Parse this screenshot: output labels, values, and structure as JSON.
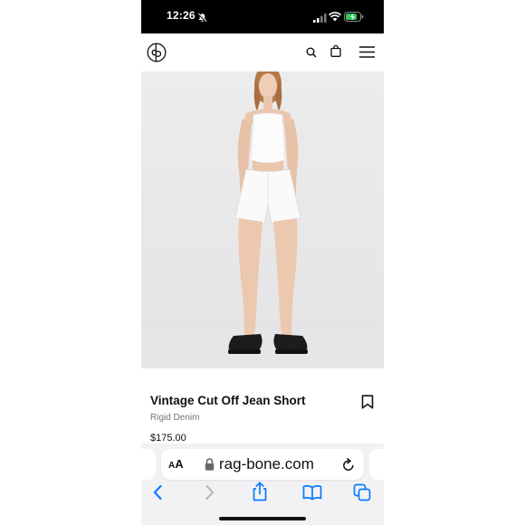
{
  "status_bar": {
    "time": "12:26",
    "icons": [
      "silent-bell-icon",
      "signal-icon",
      "wifi-icon",
      "battery-charging-icon"
    ]
  },
  "header": {
    "logo": "rb-logo-icon",
    "icons": [
      "search-icon",
      "bag-icon",
      "menu-icon"
    ]
  },
  "product": {
    "title": "Vintage Cut Off Jean Short",
    "subtitle": "Rigid Denim",
    "price": "$175.00"
  },
  "safari": {
    "text_size_small": "A",
    "text_size_large": "A",
    "url": "rag-bone.com",
    "toolbar_icons": [
      "back-icon",
      "forward-icon",
      "share-icon",
      "bookmarks-icon",
      "tabs-icon"
    ]
  },
  "colors": {
    "accent": "#0a7aff",
    "image_background": "#e9e9ea",
    "battery_green": "#34c759"
  }
}
